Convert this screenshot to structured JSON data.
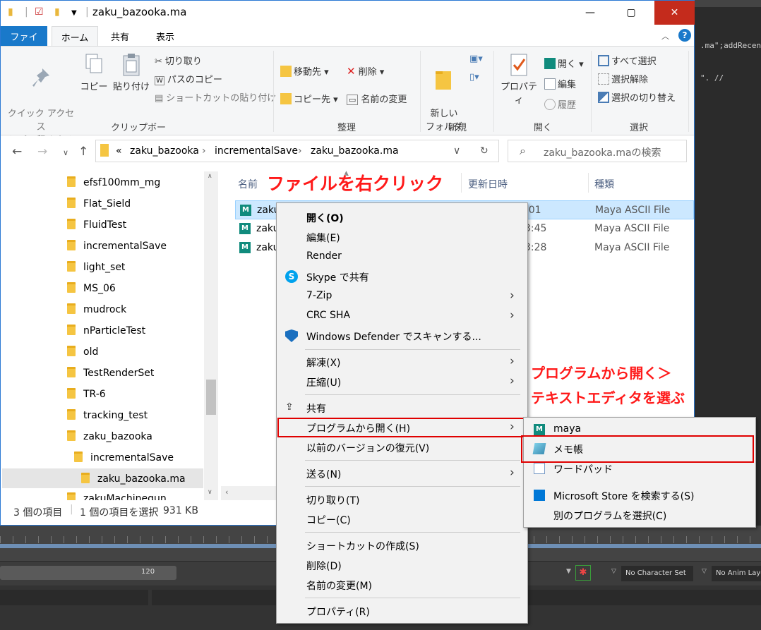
{
  "window": {
    "title": "zaku_bazooka.ma",
    "minimize_label": "—",
    "maximize_label": "▢",
    "close_label": "✕"
  },
  "ribbon_tabs": [
    "ファイル",
    "ホーム",
    "共有",
    "表示"
  ],
  "ribbon": {
    "clipboard": {
      "pin": "クイック アクセス\nにピン留めする",
      "copy": "コピー",
      "paste": "貼り付け",
      "cut": "切り取り",
      "copy_path": "パスのコピー",
      "paste_shortcut": "ショートカットの貼り付け",
      "group": "クリップボード"
    },
    "organize": {
      "move_to": "移動先",
      "copy_to": "コピー先",
      "delete": "削除",
      "rename": "名前の変更",
      "group": "整理"
    },
    "new": {
      "new_folder": "新しい\nフォルダー",
      "group": "新規"
    },
    "open": {
      "properties": "プロパティ",
      "open": "開く",
      "edit": "編集",
      "history": "履歴",
      "group": "開く"
    },
    "select": {
      "select_all": "すべて選択",
      "select_none": "選択解除",
      "invert": "選択の切り替え",
      "group": "選択"
    }
  },
  "address": {
    "prefix": "«",
    "segments": [
      "zaku_bazooka",
      "incrementalSave",
      "zaku_bazooka.ma"
    ],
    "search_placeholder": "zaku_bazooka.maの検索"
  },
  "nav_tree": [
    "efsf100mm_mg",
    "Flat_Sield",
    "FluidTest",
    "incrementalSave",
    "light_set",
    "MS_06",
    "mudrock",
    "nParticleTest",
    "old",
    "TestRenderSet",
    "TR-6",
    "tracking_test",
    "zaku_bazooka",
    "incrementalSave",
    "zaku_bazooka.ma",
    "zakuMachinegun"
  ],
  "columns": {
    "name": "名前",
    "date": "更新日時",
    "type": "種類"
  },
  "files": [
    {
      "name": "zaku",
      "date": ":01",
      "type": "Maya ASCII File"
    },
    {
      "name": "zaku",
      "date": "3:45",
      "type": "Maya ASCII File"
    },
    {
      "name": "zaku",
      "date": "3:28",
      "type": "Maya ASCII File"
    }
  ],
  "status": {
    "count": "3 個の項目",
    "selected": "1 個の項目を選択",
    "size": "931 KB"
  },
  "context_menu": [
    {
      "label": "開く(O)",
      "bold": true
    },
    {
      "label": "編集(E)"
    },
    {
      "label": "Render"
    },
    {
      "label": "Skype で共有",
      "icon": "skype-icon"
    },
    {
      "label": "7-Zip",
      "submenu": true
    },
    {
      "label": "CRC SHA",
      "submenu": true
    },
    {
      "label": "Windows Defender でスキャンする...",
      "icon": "defender-shield-icon"
    },
    {
      "label": "解凍(X)",
      "submenu": true
    },
    {
      "label": "圧縮(U)",
      "submenu": true
    },
    {
      "label": "共有",
      "icon": "share-icon"
    },
    {
      "label": "プログラムから開く(H)",
      "submenu": true
    },
    {
      "label": "以前のバージョンの復元(V)"
    },
    {
      "label": "送る(N)",
      "submenu": true
    },
    {
      "label": "切り取り(T)"
    },
    {
      "label": "コピー(C)"
    },
    {
      "label": "ショートカットの作成(S)"
    },
    {
      "label": "削除(D)"
    },
    {
      "label": "名前の変更(M)"
    },
    {
      "label": "プロパティ(R)"
    }
  ],
  "open_with_submenu": [
    {
      "label": "maya",
      "icon": "maya-icon"
    },
    {
      "label": "メモ帳",
      "icon": "notepad-icon"
    },
    {
      "label": "ワードパッド",
      "icon": "wordpad-icon"
    },
    {
      "label": "Microsoft Store を検索する(S)",
      "icon": "store-icon"
    },
    {
      "label": "別のプログラムを選択(C)"
    }
  ],
  "annotations": {
    "right_click": "ファイルを右クリック",
    "open_with_line1": "プログラムから開く＞",
    "open_with_line2": "テキストエディタを選ぶ",
    "color": "#ff1a1a"
  },
  "maya": {
    "code_line1": ".ma\";addRecen",
    "code_line2": "\". //",
    "frame_end": "120",
    "character_set": "No Character Set",
    "anim_layer": "No Anim Layer"
  },
  "colors": {
    "accent": "#1979ca",
    "selection": "#cce8ff",
    "close_button": "#c42b1c",
    "highlight_box": "#e00000"
  }
}
